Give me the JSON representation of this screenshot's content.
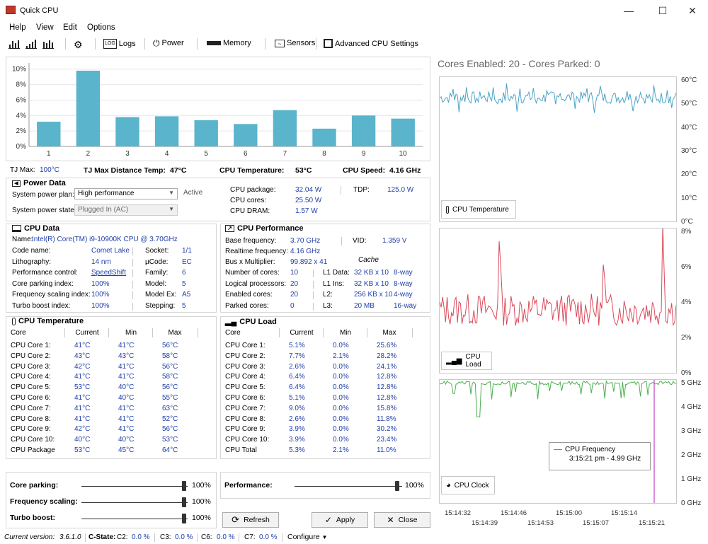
{
  "window": {
    "title": "Quick CPU"
  },
  "menu": [
    "Help",
    "View",
    "Edit",
    "Options"
  ],
  "toolbar": {
    "logs": "Logs",
    "power": "Power",
    "memory": "Memory",
    "sensors": "Sensors",
    "advanced": "Advanced CPU Settings"
  },
  "bar_chart": {
    "type": "bar",
    "categories": [
      "1",
      "2",
      "3",
      "4",
      "5",
      "6",
      "7",
      "8",
      "9",
      "10"
    ],
    "values": [
      3.2,
      9.8,
      3.8,
      3.9,
      3.4,
      2.9,
      4.7,
      2.3,
      4.0,
      3.6
    ],
    "yticks": [
      "0%",
      "2%",
      "4%",
      "6%",
      "8%",
      "10%"
    ],
    "ylim": [
      0,
      10.8
    ],
    "bar_color": "#5ab4cb"
  },
  "summary": {
    "tjmax_label": "TJ Max:",
    "tjmax_value": "100°C",
    "dist_label": "TJ Max Distance Temp:",
    "dist_value": "47°C",
    "temp_label": "CPU Temperature:",
    "temp_value": "53°C",
    "speed_label": "CPU Speed:",
    "speed_value": "4.16 GHz"
  },
  "power": {
    "title": "Power Data",
    "plan_label": "System power plan:",
    "plan_value": "High performance",
    "plan_status": "Active",
    "state_label": "System power state:",
    "state_value": "Plugged In (AC)",
    "pkg_label": "CPU package:",
    "pkg_value": "32.04 W",
    "cores_label": "CPU cores:",
    "cores_value": "25.50 W",
    "dram_label": "CPU DRAM:",
    "dram_value": "1.57 W",
    "tdp_label": "TDP:",
    "tdp_value": "125.0 W"
  },
  "cpu_data": {
    "title": "CPU Data",
    "name_label": "Name:",
    "name_value": "Intel(R) Core(TM) i9-10900K CPU @ 3.70GHz",
    "left": [
      {
        "label": "Code name:",
        "value": "Comet Lake"
      },
      {
        "label": "Lithography:",
        "value": "14 nm"
      },
      {
        "label": "Performance control:",
        "value": "SpeedShift"
      },
      {
        "label": "Core parking index:",
        "value": "100%"
      },
      {
        "label": "Frequency scaling index:",
        "value": "100%"
      },
      {
        "label": "Turbo boost index:",
        "value": "100%"
      }
    ],
    "right": [
      {
        "label": "Socket:",
        "value": "1/1"
      },
      {
        "label": "µCode:",
        "value": "EC"
      },
      {
        "label": "Family:",
        "value": "6"
      },
      {
        "label": "Model:",
        "value": "5"
      },
      {
        "label": "Model Ex:",
        "value": "A5"
      },
      {
        "label": "Stepping:",
        "value": "5"
      }
    ]
  },
  "cpu_perf": {
    "title": "CPU Performance",
    "base_label": "Base frequency:",
    "base_value": "3.70 GHz",
    "vid_label": "VID:",
    "vid_value": "1.359 V",
    "rt_label": "Realtime frequency:",
    "rt_value": "4.16 GHz",
    "bus_label": "Bus x Multiplier:",
    "bus_value": "99.892 x 41",
    "cache_label": "Cache",
    "left": [
      {
        "label": "Number of cores:",
        "value": "10"
      },
      {
        "label": "Logical processors:",
        "value": "20"
      },
      {
        "label": "Enabled cores:",
        "value": "20"
      },
      {
        "label": "Parked cores:",
        "value": "0"
      }
    ],
    "cache": [
      {
        "label": "L1 Data:",
        "size": "32 KB x 10",
        "way": "8-way"
      },
      {
        "label": "L1 Ins:",
        "size": "32 KB x 10",
        "way": "8-way"
      },
      {
        "label": "L2:",
        "size": "256 KB x 10",
        "way": "4-way"
      },
      {
        "label": "L3:",
        "size": "20 MB",
        "way": "16-way"
      }
    ]
  },
  "cpu_temp": {
    "title": "CPU Temperature",
    "headers": [
      "Core",
      "Current",
      "Min",
      "Max"
    ],
    "rows": [
      [
        "CPU Core 1:",
        "41°C",
        "41°C",
        "56°C"
      ],
      [
        "CPU Core 2:",
        "43°C",
        "43°C",
        "58°C"
      ],
      [
        "CPU Core 3:",
        "42°C",
        "41°C",
        "56°C"
      ],
      [
        "CPU Core 4:",
        "41°C",
        "41°C",
        "58°C"
      ],
      [
        "CPU Core 5:",
        "53°C",
        "40°C",
        "56°C"
      ],
      [
        "CPU Core 6:",
        "41°C",
        "40°C",
        "55°C"
      ],
      [
        "CPU Core 7:",
        "41°C",
        "41°C",
        "63°C"
      ],
      [
        "CPU Core 8:",
        "41°C",
        "41°C",
        "52°C"
      ],
      [
        "CPU Core 9:",
        "42°C",
        "41°C",
        "56°C"
      ],
      [
        "CPU Core 10:",
        "40°C",
        "40°C",
        "53°C"
      ],
      [
        "CPU Package",
        "53°C",
        "45°C",
        "64°C"
      ]
    ]
  },
  "cpu_load": {
    "title": "CPU Load",
    "headers": [
      "Core",
      "Current",
      "Min",
      "Max"
    ],
    "rows": [
      [
        "CPU Core 1:",
        "5.1%",
        "0.0%",
        "25.6%"
      ],
      [
        "CPU Core 2:",
        "7.7%",
        "2.1%",
        "28.2%"
      ],
      [
        "CPU Core 3:",
        "2.6%",
        "0.0%",
        "24.1%"
      ],
      [
        "CPU Core 4:",
        "6.4%",
        "0.0%",
        "12.8%"
      ],
      [
        "CPU Core 5:",
        "6.4%",
        "0.0%",
        "12.8%"
      ],
      [
        "CPU Core 6:",
        "5.1%",
        "0.0%",
        "12.8%"
      ],
      [
        "CPU Core 7:",
        "9.0%",
        "0.0%",
        "15.8%"
      ],
      [
        "CPU Core 8:",
        "2.6%",
        "0.0%",
        "11.8%"
      ],
      [
        "CPU Core 9:",
        "3.9%",
        "0.0%",
        "30.2%"
      ],
      [
        "CPU Core 10:",
        "3.9%",
        "0.0%",
        "23.4%"
      ],
      [
        "CPU Total",
        "5.3%",
        "2.1%",
        "11.0%"
      ]
    ]
  },
  "sliders": {
    "parking_label": "Core parking:",
    "parking_value": "100%",
    "scaling_label": "Frequency scaling:",
    "scaling_value": "100%",
    "turbo_label": "Turbo boost:",
    "turbo_value": "100%",
    "perf_label": "Performance:",
    "perf_value": "100%"
  },
  "buttons": {
    "refresh": "Refresh",
    "apply": "Apply",
    "close": "Close"
  },
  "status": {
    "version_label": "Current version:",
    "version_value": "3.6.1.0",
    "cstate_label": "C-State:",
    "c2_label": "C2:",
    "c2_value": "0.0 %",
    "c3_label": "C3:",
    "c3_value": "0.0 %",
    "c6_label": "C6:",
    "c6_value": "0.0 %",
    "c7_label": "C7:",
    "c7_value": "0.0 %",
    "configure": "Configure"
  },
  "right": {
    "cores_title": "Cores Enabled: 20 - Cores Parked: 0",
    "temp_graph": {
      "label": "CPU Temperature",
      "yticks": [
        "0°C",
        "10°C",
        "20°C",
        "30°C",
        "40°C",
        "50°C",
        "60°C"
      ],
      "ylim": [
        0,
        60
      ],
      "color": "#4aa3c7"
    },
    "load_graph": {
      "label": "CPU Load",
      "yticks": [
        "0%",
        "2%",
        "4%",
        "6%",
        "8%"
      ],
      "ylim": [
        0,
        8
      ],
      "color": "#d94a5a"
    },
    "clock_graph": {
      "label": "CPU Clock",
      "yticks": [
        "0 GHz",
        "1 GHz",
        "2 GHz",
        "3 GHz",
        "4 GHz",
        "5 GHz"
      ],
      "ylim": [
        0,
        5
      ],
      "color": "#4caf50"
    },
    "tooltip": {
      "title": "CPU Frequency",
      "value": "3:15:21 pm - 4.99 GHz"
    },
    "xticks_top": [
      "15:14:32",
      "15:14:46",
      "15:15:00",
      "15:15:14"
    ],
    "xticks_bottom": [
      "15:14:39",
      "15:14:53",
      "15:15:07",
      "15:15:21"
    ]
  }
}
